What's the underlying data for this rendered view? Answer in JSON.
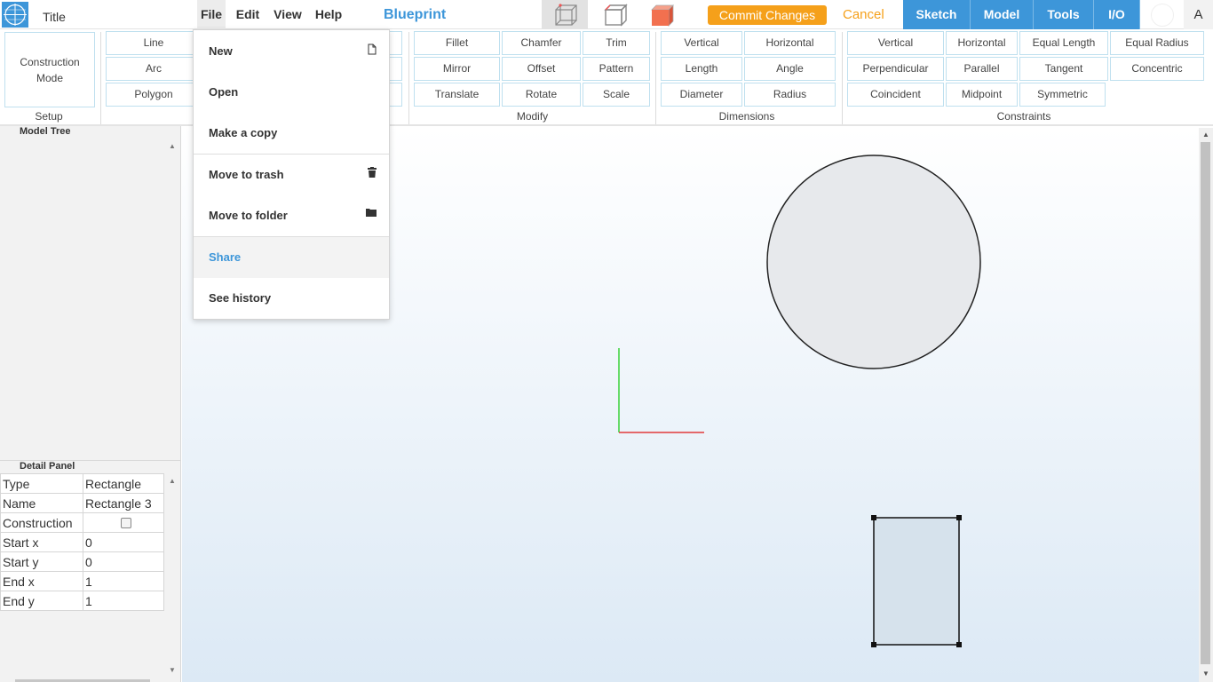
{
  "topbar": {
    "title": "Title",
    "menu": [
      "File",
      "Edit",
      "View",
      "Help"
    ],
    "brand": "Blueprint",
    "view_icons": [
      "wireframe-cube-icon",
      "outline-cube-icon",
      "solid-cube-icon"
    ],
    "commit_label": "Commit Changes",
    "cancel_label": "Cancel",
    "mode_tabs": [
      "Sketch",
      "Model",
      "Tools",
      "I/O"
    ],
    "account_label": "A"
  },
  "ribbon": {
    "construction_mode": "Construction Mode",
    "groups": {
      "setup": "Setup",
      "modify": "Modify",
      "dimensions": "Dimensions",
      "constraints": "Constraints"
    },
    "draw": [
      "Line",
      "Arc",
      "Polygon"
    ],
    "modify": [
      "Fillet",
      "Chamfer",
      "Trim",
      "Mirror",
      "Offset",
      "Pattern",
      "Translate",
      "Rotate",
      "Scale"
    ],
    "dimensions": [
      "Vertical",
      "Horizontal",
      "Length",
      "Angle",
      "Diameter",
      "Radius"
    ],
    "constraints": [
      "Vertical",
      "Horizontal",
      "Equal Length",
      "Equal Radius",
      "Perpendicular",
      "Parallel",
      "Tangent",
      "Concentric",
      "Coincident",
      "Midpoint",
      "Symmetric"
    ]
  },
  "panels": {
    "model_tree": "Model Tree",
    "detail_panel": "Detail Panel"
  },
  "details": [
    {
      "key": "Type",
      "value": "Rectangle"
    },
    {
      "key": "Name",
      "value": "Rectangle 3"
    },
    {
      "key": "Construction",
      "value": ""
    },
    {
      "key": "Start x",
      "value": "0"
    },
    {
      "key": "Start y",
      "value": "0"
    },
    {
      "key": "End x",
      "value": "1"
    },
    {
      "key": "End y",
      "value": "1"
    }
  ],
  "file_menu": [
    "New",
    "Open",
    "Make a copy",
    "Move to trash",
    "Move to folder",
    "Share",
    "See history"
  ],
  "colors": {
    "accent": "#3d96d9",
    "commit": "#f5a01a",
    "x_axis": "#e23a3a",
    "y_axis": "#3ad23a"
  }
}
